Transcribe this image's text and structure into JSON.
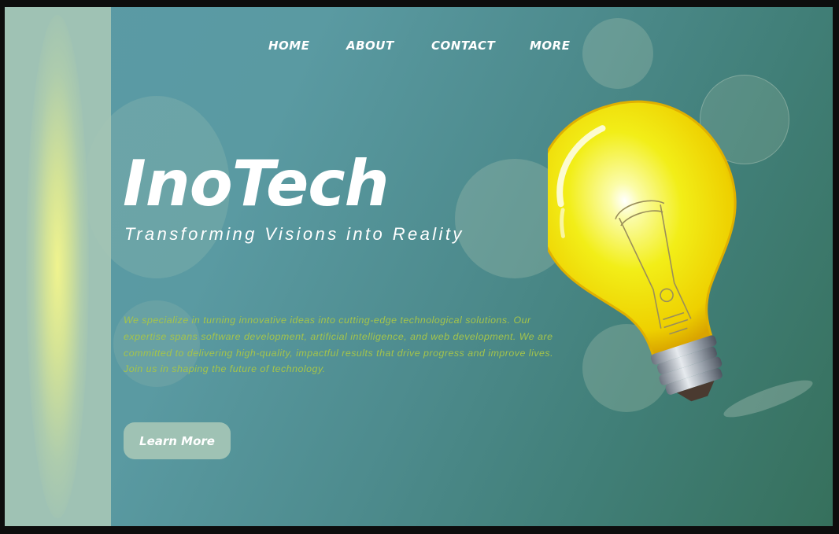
{
  "nav": {
    "items": [
      {
        "label": "HOME"
      },
      {
        "label": "ABOUT"
      },
      {
        "label": "CONTACT"
      },
      {
        "label": "MORE"
      }
    ]
  },
  "hero": {
    "title": "InoTech",
    "tagline": "Transforming Visions into Reality",
    "description": "We specialize in turning innovative ideas into cutting-edge technological solutions. Our expertise spans software development, artificial intelligence, and web development. We are committed to delivering high-quality, impactful results that drive progress and improve lives. Join us in shaping the future of technology.",
    "cta_label": "Learn More"
  },
  "colors": {
    "background_start": "#5b9aa6",
    "background_end": "#36705c",
    "sidebar": "#9fc2b4",
    "description_text": "#a5c44a",
    "button": "#9fc2b4",
    "bulb": "#f4e200"
  },
  "icons": {
    "hero_image": "lightbulb-icon"
  }
}
